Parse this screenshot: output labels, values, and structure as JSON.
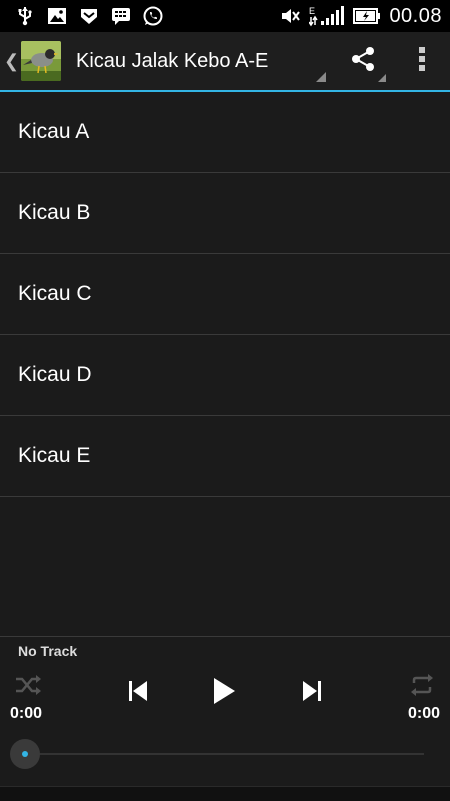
{
  "status_bar": {
    "time": "00.08",
    "left_icons": [
      "usb-icon",
      "image-icon",
      "shield-icon",
      "bbm-icon",
      "whatsapp-icon"
    ],
    "right_icons": [
      "mute-icon",
      "signal-icon",
      "battery-icon"
    ],
    "network_label": "E"
  },
  "action_bar": {
    "title": "Kicau Jalak Kebo A-E",
    "accent_color": "#33b5e5"
  },
  "list": {
    "items": [
      {
        "label": "Kicau A"
      },
      {
        "label": "Kicau B"
      },
      {
        "label": "Kicau C"
      },
      {
        "label": "Kicau D"
      },
      {
        "label": "Kicau E"
      }
    ]
  },
  "player": {
    "track": "No Track",
    "elapsed": "0:00",
    "duration": "0:00",
    "progress": 0,
    "accent_color": "#33b5e5"
  }
}
